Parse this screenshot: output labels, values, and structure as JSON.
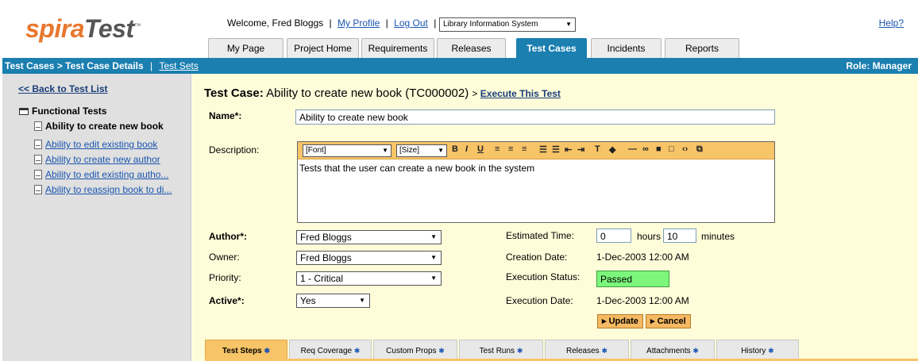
{
  "header": {
    "logo_a": "spira",
    "logo_b": "Test",
    "logo_tm": "™",
    "welcome": "Welcome, Fred Bloggs",
    "sep1": "|",
    "my_profile": "My Profile",
    "sep2": "|",
    "log_out": "Log Out",
    "sep3": "|",
    "project": "Library Information System",
    "help": "Help?"
  },
  "tabs": [
    {
      "label": "My Page"
    },
    {
      "label": "Project Home"
    },
    {
      "label": "Requirements"
    },
    {
      "label": "Releases"
    },
    {
      "label": "Test Cases"
    },
    {
      "label": "Incidents"
    },
    {
      "label": "Reports"
    }
  ],
  "bluebar": {
    "crumb": "Test Cases > Test Case Details",
    "sep": "|",
    "test_sets": "Test Sets",
    "role": "Role: Manager"
  },
  "sidebar": {
    "back": "<< Back to Test List",
    "folder": "Functional Tests",
    "items": [
      {
        "label": "Ability to create new book"
      },
      {
        "label": "Ability to edit existing book"
      },
      {
        "label": "Ability to create new author"
      },
      {
        "label": "Ability to edit existing autho..."
      },
      {
        "label": "Ability to reassign book to di..."
      }
    ]
  },
  "main": {
    "title_prefix": "Test Case:",
    "title_text": "Ability to create new book (TC000002)",
    "exec_prefix": ">",
    "exec_link": "Execute This Test",
    "name_label": "Name*:",
    "name_value": "Ability to create new book",
    "desc_label": "Description:",
    "font_select": "[Font]",
    "size_select": "[Size]",
    "desc_value": "Tests that the user can create a new book in the system",
    "author_label": "Author*:",
    "author_value": "Fred Bloggs",
    "owner_label": "Owner:",
    "owner_value": "Fred Bloggs",
    "priority_label": "Priority:",
    "priority_value": "1 - Critical",
    "active_label": "Active*:",
    "active_value": "Yes",
    "est_label": "Estimated Time:",
    "est_hours": "0",
    "hours_label": "hours",
    "est_minutes": "10",
    "minutes_label": "minutes",
    "created_label": "Creation Date:",
    "created_value": "1-Dec-2003 12:00 AM",
    "exec_status_label": "Execution Status:",
    "exec_status_value": "Passed",
    "exec_date_label": "Execution Date:",
    "exec_date_value": "1-Dec-2003 12:00 AM",
    "update_btn": "▸ Update",
    "cancel_btn": "▸ Cancel"
  },
  "bottom_tabs": [
    {
      "label": "Test Steps"
    },
    {
      "label": "Req Coverage"
    },
    {
      "label": "Custom Props"
    },
    {
      "label": "Test Runs"
    },
    {
      "label": "Releases"
    },
    {
      "label": "Attachments"
    },
    {
      "label": "History"
    }
  ],
  "colors": {
    "accent_blue": "#1b7fb0",
    "tab_orange": "#f7c468",
    "passed_green": "#7cf77c",
    "panel_yellow": "#fffdd9"
  }
}
